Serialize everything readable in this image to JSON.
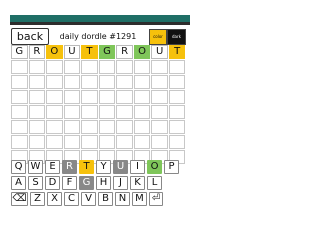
{
  "header": {
    "back_label": "back",
    "title": "daily dordle #1291",
    "color_label": "color",
    "dark_label": "dark"
  },
  "board": {
    "columns": 10,
    "rows": [
      {
        "letters": [
          "G",
          "R",
          "O",
          "U",
          "T",
          "G",
          "R",
          "O",
          "U",
          "T"
        ],
        "states": [
          "none",
          "none",
          "yellow",
          "none",
          "yellow",
          "green",
          "none",
          "green",
          "none",
          "yellow"
        ]
      },
      {
        "letters": [
          "",
          "",
          "",
          "",
          "",
          "",
          "",
          "",
          "",
          ""
        ],
        "states": []
      },
      {
        "letters": [
          "",
          "",
          "",
          "",
          "",
          "",
          "",
          "",
          "",
          ""
        ],
        "states": []
      },
      {
        "letters": [
          "",
          "",
          "",
          "",
          "",
          "",
          "",
          "",
          "",
          ""
        ],
        "states": []
      },
      {
        "letters": [
          "",
          "",
          "",
          "",
          "",
          "",
          "",
          "",
          "",
          ""
        ],
        "states": []
      },
      {
        "letters": [
          "",
          "",
          "",
          "",
          "",
          "",
          "",
          "",
          "",
          ""
        ],
        "states": []
      },
      {
        "letters": [
          "",
          "",
          "",
          "",
          "",
          "",
          "",
          "",
          "",
          ""
        ],
        "states": []
      },
      {
        "letters": [
          "",
          "",
          "",
          "",
          "",
          "",
          "",
          "",
          "",
          ""
        ],
        "states": []
      }
    ]
  },
  "keyboard": {
    "rows": [
      [
        {
          "k": "Q",
          "s": "none"
        },
        {
          "k": "W",
          "s": "none"
        },
        {
          "k": "E",
          "s": "none"
        },
        {
          "k": "R",
          "s": "gray"
        },
        {
          "k": "T",
          "s": "yellow"
        },
        {
          "k": "Y",
          "s": "none"
        },
        {
          "k": "U",
          "s": "gray"
        },
        {
          "k": "I",
          "s": "none"
        },
        {
          "k": "O",
          "s": "green"
        },
        {
          "k": "P",
          "s": "none"
        }
      ],
      [
        {
          "k": "A",
          "s": "none"
        },
        {
          "k": "S",
          "s": "none"
        },
        {
          "k": "D",
          "s": "none"
        },
        {
          "k": "F",
          "s": "none"
        },
        {
          "k": "G",
          "s": "gray"
        },
        {
          "k": "H",
          "s": "none"
        },
        {
          "k": "J",
          "s": "none"
        },
        {
          "k": "K",
          "s": "none"
        },
        {
          "k": "L",
          "s": "none"
        }
      ],
      [
        {
          "k": "⌫",
          "s": "none"
        },
        {
          "k": "Z",
          "s": "none"
        },
        {
          "k": "X",
          "s": "none"
        },
        {
          "k": "C",
          "s": "none"
        },
        {
          "k": "V",
          "s": "none"
        },
        {
          "k": "B",
          "s": "none"
        },
        {
          "k": "N",
          "s": "none"
        },
        {
          "k": "M",
          "s": "none"
        },
        {
          "k": "⏎",
          "s": "none"
        }
      ]
    ]
  },
  "colors": {
    "accent": "#1f6f66",
    "yellow": "#f6c10c",
    "green": "#7fc65a",
    "gray": "#888888"
  }
}
